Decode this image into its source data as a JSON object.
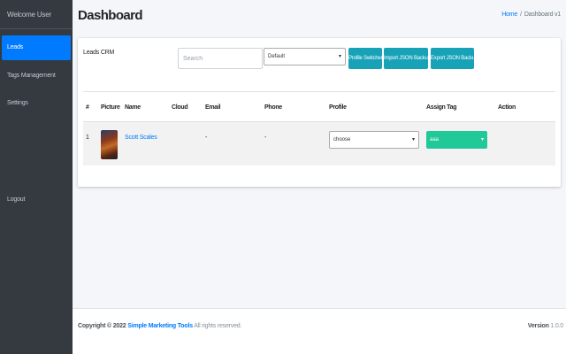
{
  "sidebar": {
    "welcome": "Welcome User",
    "items": [
      {
        "label": "Leads",
        "active": true
      },
      {
        "label": "Tags Management",
        "active": false
      },
      {
        "label": "Settings",
        "active": false
      },
      {
        "label": "Logout",
        "active": false
      }
    ]
  },
  "header": {
    "title": "Dashboard",
    "breadcrumb": {
      "home": "Home",
      "separator": "/",
      "current": "Dashboard v1"
    }
  },
  "card": {
    "title": "Leads CRM",
    "search_placeholder": "Search",
    "profile_select": "Default",
    "buttons": {
      "profile_switcher": "Profile Switcher",
      "import": "Import JSON Backup",
      "export": "Export JSON Backup"
    }
  },
  "table": {
    "headers": {
      "num": "#",
      "picture": "Picture",
      "name": "Name",
      "cloud": "Cloud",
      "email": "Email",
      "phone": "Phone",
      "profile": "Profile",
      "assign_tag": "Assign Tag",
      "action": "Action"
    },
    "rows": [
      {
        "num": "1",
        "name": "Scott Scales",
        "cloud": "",
        "email": "-",
        "phone": "-",
        "profile": "choose",
        "assign_tag": "aaa",
        "action": ""
      }
    ]
  },
  "footer": {
    "copyright_prefix": "Copyright © 2022",
    "brand": "Simple Marketing Tools",
    "rights": "All rights reserved.",
    "version_label": "Version",
    "version": "1.0.0"
  },
  "colors": {
    "sidebar_bg": "#343a40",
    "active": "#007bff",
    "button": "#17a2b8",
    "tag": "#20c997"
  }
}
